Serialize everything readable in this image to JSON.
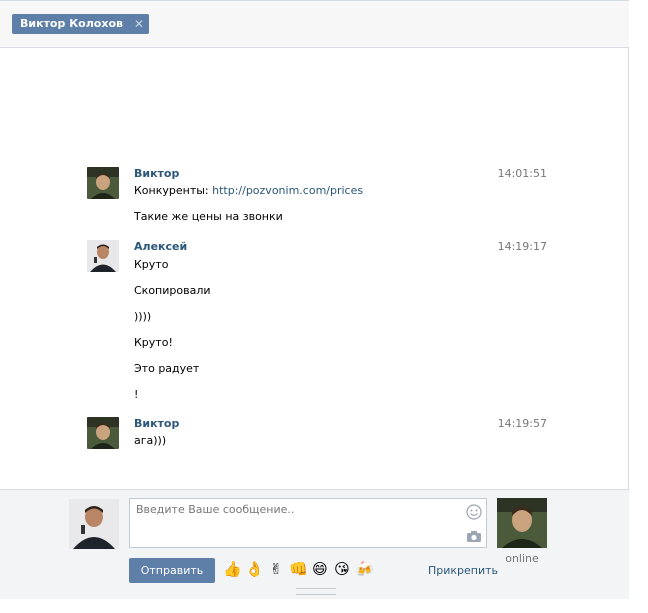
{
  "tab": {
    "title": "Виктор Колохов",
    "close_glyph": "✕"
  },
  "messages": [
    {
      "author": "Виктор",
      "time": "14:01:51",
      "avatar": "viktor-photo",
      "lines": [
        {
          "prefix": "Конкуренты: ",
          "link": "http://pozvonim.com/prices"
        },
        {
          "text": "Такие же цены на звонки"
        }
      ]
    },
    {
      "author": "Алексей",
      "time": "14:19:17",
      "avatar": "aleksey-photo",
      "lines": [
        {
          "text": "Круто"
        },
        {
          "text": "Скопировали"
        },
        {
          "text": "))))"
        },
        {
          "text": "Круто!"
        },
        {
          "text": "Это радует"
        },
        {
          "text": "!"
        }
      ]
    },
    {
      "author": "Виктор",
      "time": "14:19:57",
      "avatar": "viktor-photo",
      "lines": [
        {
          "text": "ага)))"
        }
      ]
    }
  ],
  "composer": {
    "placeholder": "Введите Ваше сообщение..",
    "send_label": "Отправить",
    "attach_label": "Прикрепить",
    "peer_status": "online",
    "emojis": [
      "👍",
      "👌",
      "✌",
      "👊",
      "😄",
      "😘",
      "🍻"
    ]
  },
  "colors": {
    "accent": "#5e7fa8",
    "link": "#2b587a",
    "footer_bg": "#f3f4f6"
  }
}
